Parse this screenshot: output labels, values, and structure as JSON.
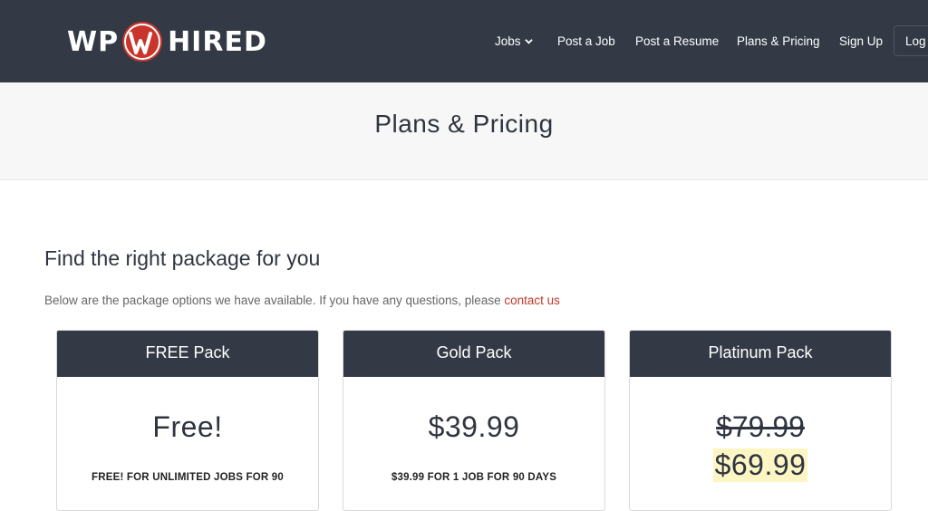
{
  "brand": {
    "left": "WP",
    "right": "HIRED",
    "logo_color": "#c9352b"
  },
  "nav": {
    "jobs": "Jobs",
    "post_job": "Post a Job",
    "post_resume": "Post a Resume",
    "plans": "Plans & Pricing",
    "signup": "Sign Up",
    "login": "Log In"
  },
  "page": {
    "title": "Plans & Pricing",
    "heading": "Find the right package for you",
    "intro": "Below are the package options we have available. If you have any questions, please ",
    "contact_link": "contact us"
  },
  "packages": [
    {
      "name": "FREE Pack",
      "price": "Free!",
      "description": "FREE! FOR UNLIMITED JOBS FOR 90"
    },
    {
      "name": "Gold Pack",
      "price": "$39.99",
      "description": "$39.99 FOR 1 JOB FOR 90 DAYS"
    },
    {
      "name": "Platinum Pack",
      "old_price": "$79.99",
      "sale_price": "$69.99"
    }
  ],
  "colors": {
    "header_bg": "#333a46",
    "link": "#c0392b",
    "highlight": "#fdf5c4"
  }
}
